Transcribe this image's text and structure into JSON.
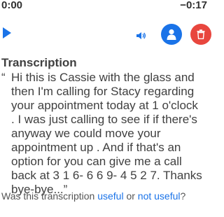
{
  "player": {
    "elapsed": "0:00",
    "remaining": "−0:17"
  },
  "icons": {
    "play": "play-icon",
    "speaker": "speaker-icon",
    "contact": "person-icon",
    "delete": "trash-icon"
  },
  "colors": {
    "accent": "#1a73e8",
    "danger": "#e8463e",
    "text": "#404040"
  },
  "transcription": {
    "title": "Transcription",
    "open_quote": "“",
    "text": "Hi this is Cassie with the glass and then I'm calling for Stacy regarding your appointment today at 1 o'clock . I was just calling to see if if there's anyway we could move your appointment up . And if that's an option for you can give me a call back at 3 1 6- 6 6 9- 4 5 2 7. Thanks bye-bye...”"
  },
  "feedback": {
    "prefix": "Was this transcription ",
    "useful_label": "useful",
    "middle": " or ",
    "not_useful_label": "not useful",
    "suffix": "?"
  }
}
